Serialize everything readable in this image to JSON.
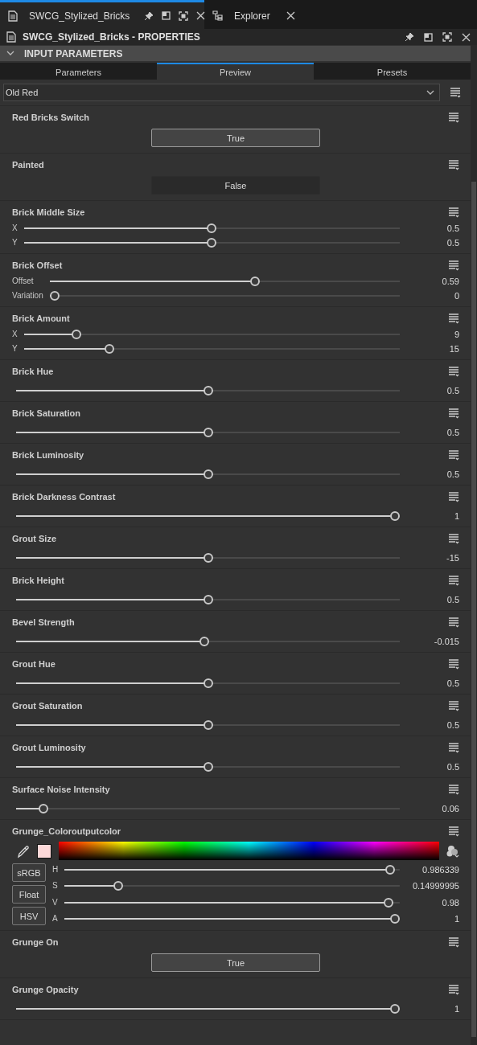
{
  "doc_tabs": [
    {
      "label": "SWCG_Stylized_Bricks",
      "selected": true,
      "kind": "doc"
    },
    {
      "label": "Explorer",
      "selected": false,
      "kind": "tree"
    }
  ],
  "panel": {
    "title": "SWCG_Stylized_Bricks - PROPERTIES"
  },
  "section": {
    "title": "INPUT PARAMETERS",
    "expanded": true
  },
  "tabs": [
    {
      "label": "Parameters",
      "selected": false
    },
    {
      "label": "Preview",
      "selected": true
    },
    {
      "label": "Presets",
      "selected": false
    }
  ],
  "preset": {
    "value": "Old Red"
  },
  "params": [
    {
      "kind": "toggle",
      "label": "Red Bricks Switch",
      "value": "True",
      "on": true
    },
    {
      "kind": "toggle",
      "label": "Painted",
      "value": "False",
      "on": false
    },
    {
      "kind": "slider",
      "label": "Brick Middle Size",
      "rows": [
        {
          "axis": "X",
          "level": 0.5,
          "reading": "0.5"
        },
        {
          "axis": "Y",
          "level": 0.5,
          "reading": "0.5"
        }
      ]
    },
    {
      "kind": "slider",
      "label": "Brick Offset",
      "rows": [
        {
          "axis": "Offset",
          "level": 0.59,
          "reading": "0.59"
        },
        {
          "axis": "Variation",
          "level": 0,
          "reading": "0"
        }
      ]
    },
    {
      "kind": "slider",
      "label": "Brick Amount",
      "rows": [
        {
          "axis": "X",
          "level": 0.13,
          "reading": "9"
        },
        {
          "axis": "Y",
          "level": 0.22,
          "reading": "15"
        }
      ]
    },
    {
      "kind": "slider",
      "label": "Brick Hue",
      "rows": [
        {
          "level": 0.5,
          "reading": "0.5"
        }
      ]
    },
    {
      "kind": "slider",
      "label": "Brick Saturation",
      "rows": [
        {
          "level": 0.5,
          "reading": "0.5"
        }
      ]
    },
    {
      "kind": "slider",
      "label": "Brick Luminosity",
      "rows": [
        {
          "level": 0.5,
          "reading": "0.5"
        }
      ]
    },
    {
      "kind": "slider",
      "label": "Brick Darkness Contrast",
      "rows": [
        {
          "level": 1,
          "reading": "1"
        }
      ]
    },
    {
      "kind": "slider",
      "label": "Grout Size",
      "rows": [
        {
          "level": 0.5,
          "reading": "-15"
        }
      ]
    },
    {
      "kind": "slider",
      "label": "Brick Height",
      "rows": [
        {
          "level": 0.5,
          "reading": "0.5"
        }
      ]
    },
    {
      "kind": "slider",
      "label": "Bevel Strength",
      "rows": [
        {
          "level": 0.49,
          "reading": "-0.015"
        }
      ]
    },
    {
      "kind": "slider",
      "label": "Grout Hue",
      "rows": [
        {
          "level": 0.5,
          "reading": "0.5"
        }
      ]
    },
    {
      "kind": "slider",
      "label": "Grout Saturation",
      "rows": [
        {
          "level": 0.5,
          "reading": "0.5"
        }
      ]
    },
    {
      "kind": "slider",
      "label": "Grout Luminosity",
      "rows": [
        {
          "level": 0.5,
          "reading": "0.5"
        }
      ]
    },
    {
      "kind": "slider",
      "label": "Surface Noise Intensity",
      "rows": [
        {
          "level": 0.06,
          "reading": "0.06"
        }
      ]
    },
    {
      "kind": "color",
      "label": "Grunge_Coloroutputcolor",
      "color": "#fcd8d8",
      "modes": [
        "sRGB",
        "Float",
        "HSV"
      ],
      "rows": [
        {
          "axis": "H",
          "level": 0.986,
          "reading": "0.986339"
        },
        {
          "axis": "S",
          "level": 0.15,
          "reading": "0.14999995"
        },
        {
          "axis": "V",
          "level": 0.98,
          "reading": "0.98"
        },
        {
          "axis": "A",
          "level": 1,
          "reading": "1"
        }
      ]
    },
    {
      "kind": "toggle",
      "label": "Grunge On",
      "value": "True",
      "on": true
    },
    {
      "kind": "slider",
      "label": "Grunge Opacity",
      "rows": [
        {
          "level": 1,
          "reading": "1"
        }
      ]
    }
  ]
}
